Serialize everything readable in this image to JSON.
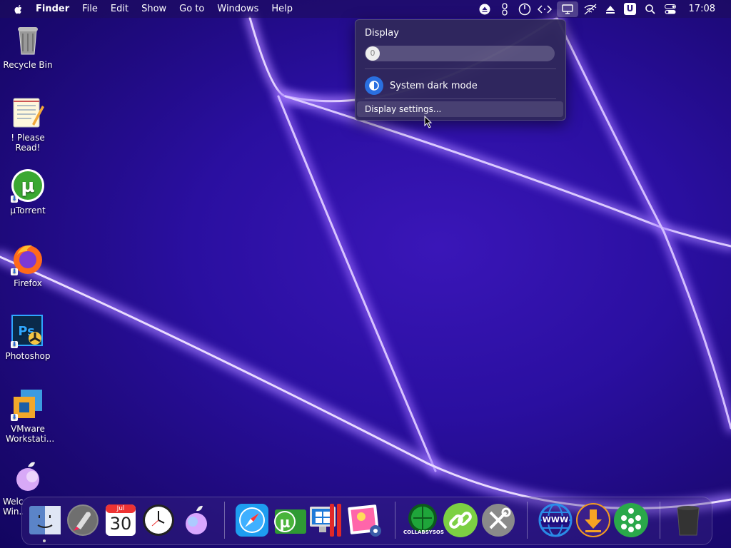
{
  "menubar": {
    "app_name": "Finder",
    "items": [
      "File",
      "Edit",
      "Show",
      "Go to",
      "Windows",
      "Help"
    ],
    "clock": "17:08",
    "tray_letter": "U"
  },
  "desktop_icons": [
    {
      "label": "Recycle Bin"
    },
    {
      "label": "! Please Read!"
    },
    {
      "label": "µTorrent"
    },
    {
      "label": "Firefox"
    },
    {
      "label": "Photoshop"
    },
    {
      "label": "VMware Workstati..."
    },
    {
      "label": "Welc... Win..."
    }
  ],
  "display_popup": {
    "title": "Display",
    "slider_value": "0",
    "dark_mode_label": "System dark mode",
    "settings_label": "Display settings..."
  },
  "dock": {
    "calendar_month": "Jul",
    "calendar_day": "30",
    "collabsysos_label": "COLLABSYSOS",
    "www_label": "WWW"
  }
}
